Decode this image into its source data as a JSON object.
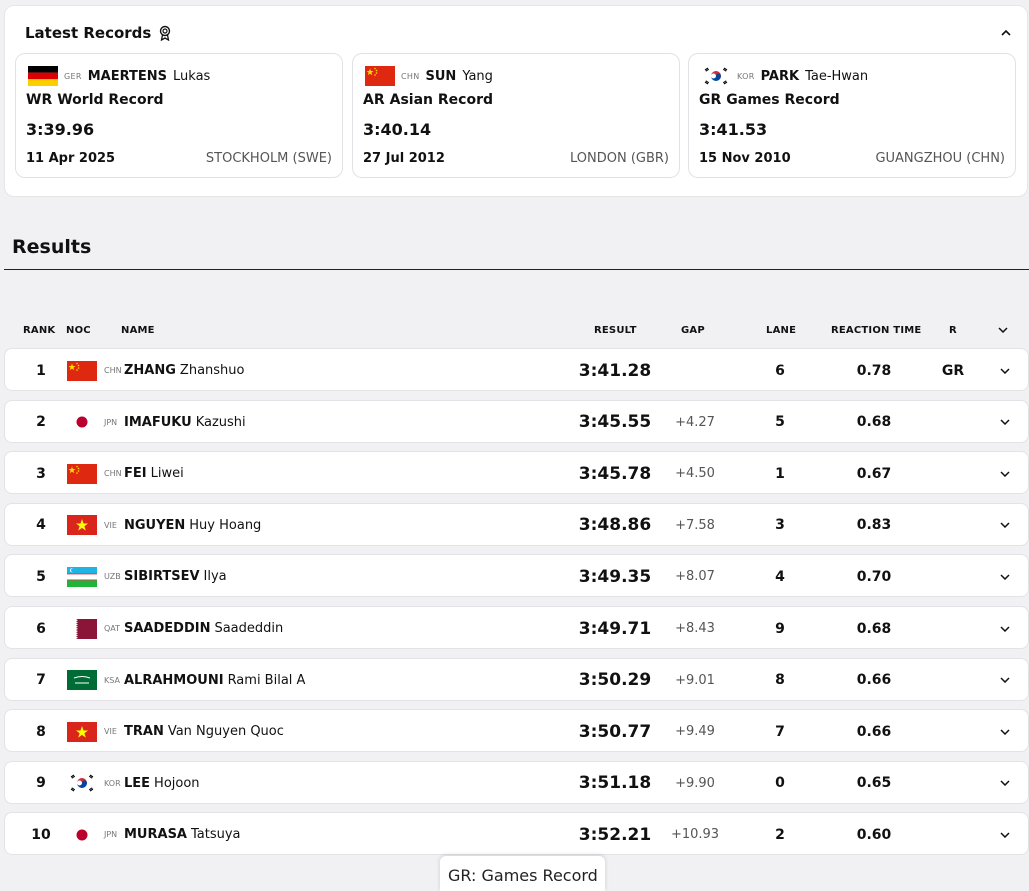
{
  "latest_records": {
    "title": "Latest Records",
    "cards": [
      {
        "noc": "GER",
        "family": "MAERTENS",
        "given": "Lukas",
        "code": "WR",
        "label": "World Record",
        "time": "3:39.96",
        "date": "11 Apr 2025",
        "place": "STOCKHOLM (SWE)"
      },
      {
        "noc": "CHN",
        "family": "SUN",
        "given": "Yang",
        "code": "AR",
        "label": "Asian Record",
        "time": "3:40.14",
        "date": "27 Jul 2012",
        "place": "LONDON (GBR)"
      },
      {
        "noc": "KOR",
        "family": "PARK",
        "given": "Tae-Hwan",
        "code": "GR",
        "label": "Games Record",
        "time": "3:41.53",
        "date": "15 Nov 2010",
        "place": "GUANGZHOU (CHN)"
      }
    ]
  },
  "results": {
    "title": "Results",
    "columns": {
      "rank": "RANK",
      "noc": "NOC",
      "name": "NAME",
      "result": "RESULT",
      "gap": "GAP",
      "lane": "LANE",
      "reaction": "REACTION TIME",
      "record": "R"
    },
    "rows": [
      {
        "rank": "1",
        "noc": "CHN",
        "family": "ZHANG",
        "given": "Zhanshuo",
        "result": "3:41.28",
        "gap": "",
        "lane": "6",
        "reaction": "0.78",
        "record": "GR"
      },
      {
        "rank": "2",
        "noc": "JPN",
        "family": "IMAFUKU",
        "given": "Kazushi",
        "result": "3:45.55",
        "gap": "+4.27",
        "lane": "5",
        "reaction": "0.68",
        "record": ""
      },
      {
        "rank": "3",
        "noc": "CHN",
        "family": "FEI",
        "given": "Liwei",
        "result": "3:45.78",
        "gap": "+4.50",
        "lane": "1",
        "reaction": "0.67",
        "record": ""
      },
      {
        "rank": "4",
        "noc": "VIE",
        "family": "NGUYEN",
        "given": "Huy Hoang",
        "result": "3:48.86",
        "gap": "+7.58",
        "lane": "3",
        "reaction": "0.83",
        "record": ""
      },
      {
        "rank": "5",
        "noc": "UZB",
        "family": "SIBIRTSEV",
        "given": "Ilya",
        "result": "3:49.35",
        "gap": "+8.07",
        "lane": "4",
        "reaction": "0.70",
        "record": ""
      },
      {
        "rank": "6",
        "noc": "QAT",
        "family": "SAADEDDIN",
        "given": "Saadeddin",
        "result": "3:49.71",
        "gap": "+8.43",
        "lane": "9",
        "reaction": "0.68",
        "record": ""
      },
      {
        "rank": "7",
        "noc": "KSA",
        "family": "ALRAHMOUNI",
        "given": "Rami Bilal A",
        "result": "3:50.29",
        "gap": "+9.01",
        "lane": "8",
        "reaction": "0.66",
        "record": ""
      },
      {
        "rank": "8",
        "noc": "VIE",
        "family": "TRAN",
        "given": "Van Nguyen Quoc",
        "result": "3:50.77",
        "gap": "+9.49",
        "lane": "7",
        "reaction": "0.66",
        "record": ""
      },
      {
        "rank": "9",
        "noc": "KOR",
        "family": "LEE",
        "given": "Hojoon",
        "result": "3:51.18",
        "gap": "+9.90",
        "lane": "0",
        "reaction": "0.65",
        "record": ""
      },
      {
        "rank": "10",
        "noc": "JPN",
        "family": "MURASA",
        "given": "Tatsuya",
        "result": "3:52.21",
        "gap": "+10.93",
        "lane": "2",
        "reaction": "0.60",
        "record": ""
      }
    ]
  },
  "tooltip": {
    "text": "GR: Games Record"
  },
  "colors": {
    "china_red": "#de2910",
    "china_yellow": "#ffde00",
    "japan_red": "#bc002d",
    "vietnam_red": "#da251d",
    "qatar_maroon": "#8a1538",
    "saudi_green": "#006c35",
    "uzb_blue": "#1eb5e5",
    "uzb_green": "#1eb53a",
    "korea_red": "#cd2e3a",
    "korea_blue": "#0047a0"
  }
}
